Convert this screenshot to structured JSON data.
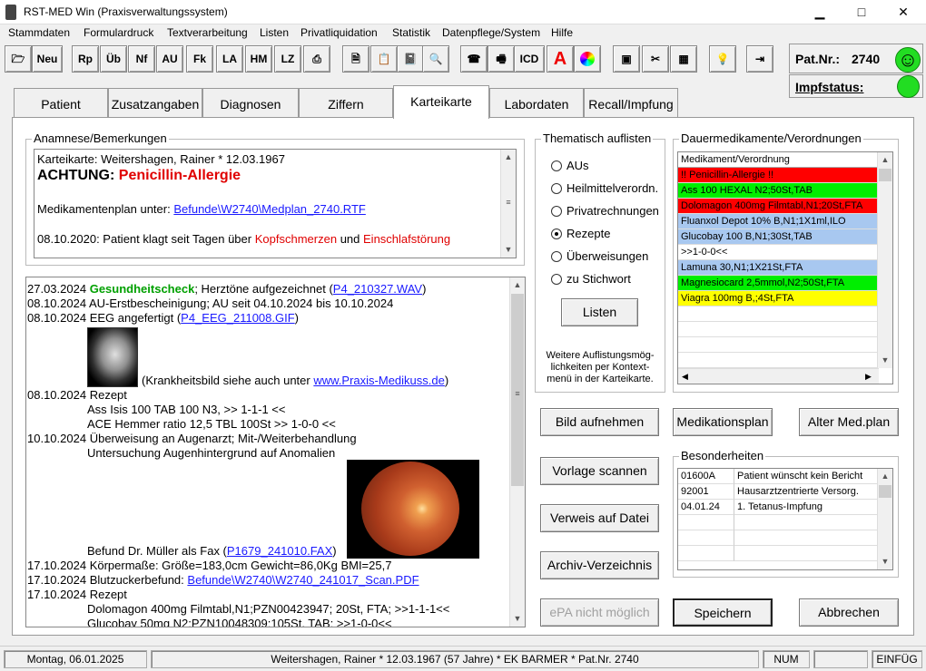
{
  "window": {
    "title": "RST-MED Win (Praxisverwaltungssystem)",
    "minimize": "▁",
    "maximize": "□",
    "close": "✕"
  },
  "menu": [
    "Stammdaten",
    "Formulardruck",
    "Textverarbeitung",
    "Listen",
    "Privatliquidation",
    "Statistik",
    "Datenpflege/System",
    "Hilfe"
  ],
  "toolbar": {
    "text_buttons": [
      "Neu",
      "Rp",
      "Üb",
      "Nf",
      "AU",
      "Fk",
      "LA",
      "HM",
      "LZ",
      "ICD"
    ],
    "icons": [
      "open-folder-icon",
      "printer-icon",
      "document-icon",
      "clipboard-icon",
      "notebook-icon",
      "magnifier-icon",
      "telephone-icon",
      "fax-icon",
      "pharmacy-icon",
      "color-wheel-icon",
      "safe-icon",
      "tools-icon",
      "calculator-icon",
      "lightbulb-icon",
      "exit-icon"
    ]
  },
  "patient": {
    "label": "Pat.Nr.:",
    "number": "2740",
    "impf_label": "Impfstatus:",
    "smiley": "☺"
  },
  "tabs": [
    "Patient",
    "Zusatzangaben",
    "Diagnosen",
    "Ziffern",
    "Karteikarte",
    "Labordaten",
    "Recall/Impfung"
  ],
  "anamnese": {
    "label": "Anamnese/Bemerkungen",
    "line1": "Karteikarte: Weitershagen, Rainer * 12.03.1967",
    "achtung": "ACHTUNG:",
    "allergy": "Penicillin-Allergie",
    "medplan_prefix": "Medikamentenplan unter:",
    "medplan_link": "Befunde\\W2740\\Medplan_2740.RTF",
    "note_prefix": "08.10.2020: Patient klagt seit Tagen über",
    "note_sym1": "Kopfschmerzen",
    "note_and": "und",
    "note_sym2": "Einschlafstörung"
  },
  "kartei": {
    "r1_date": "27.03.2024",
    "r1_green": "Gesundheitscheck",
    "r1_text": "; Herztöne aufgezeichnet (",
    "r1_link": "P4_210327.WAV",
    "r1_end": ")",
    "r2_date": "08.10.2024",
    "r2_text": "AU-Erstbescheinigung; AU seit 04.10.2024 bis 10.10.2024",
    "r3_date": "08.10.2024",
    "r3_text": "EEG angefertigt (",
    "r3_link": "P4_EEG_211008.GIF",
    "r3_end": ")",
    "r3_img_note": "(Krankheitsbild siehe auch unter",
    "r3_img_link": "www.Praxis-Medikuss.de",
    "r3_img_end": ")",
    "r4_date": "08.10.2024",
    "r4_text": "Rezept",
    "r4_l1": "Ass Isis 100 TAB 100 N3, >> 1-1-1 <<",
    "r4_l2": "ACE Hemmer ratio 12,5 TBL 100St >> 1-0-0 <<",
    "r5_date": "10.10.2024",
    "r5_text": "Überweisung an Augenarzt; Mit-/Weiterbehandlung",
    "r5_l1": "Untersuchung Augenhintergrund auf Anomalien",
    "r5_fax_text": "Befund Dr. Müller als Fax (",
    "r5_fax_link": "P1679_241010.FAX",
    "r5_fax_end": ")",
    "r6_date": "17.10.2024",
    "r6_text": "Körpermaße: Größe=183,0cm    Gewicht=86,0Kg    BMI=25,7",
    "r7_date": "17.10.2024",
    "r7_text": "Blutzuckerbefund:",
    "r7_link": "Befunde\\W2740\\W2740_241017_Scan.PDF",
    "r8_date": "17.10.2024",
    "r8_text": "Rezept",
    "r8_l1": "Dolomagon 400mg Filmtabl,N1;PZN00423947; 20St, FTA; >>1-1-1<<",
    "r8_l2": "Glucobay 50mg N2;PZN10048309;105St, TAB; >>1-0-0<<"
  },
  "thematisch": {
    "label": "Thematisch auflisten",
    "options": [
      "AUs",
      "Heilmittelverordn.",
      "Privatrechnungen",
      "Rezepte",
      "Überweisungen",
      "zu Stichwort"
    ],
    "selected": "Rezepte",
    "button": "Listen",
    "hint1": "Weitere Auflistungsmög-",
    "hint2": "lichkeiten per Kontext-",
    "hint3": "menü in der Karteikarte."
  },
  "dauer": {
    "label": "Dauermedikamente/Verordnungen",
    "header": "Medikament/Verordnung",
    "rows": [
      {
        "text": "!! Penicillin-Allergie !!",
        "color": "#ff0000"
      },
      {
        "text": "Ass 100 HEXAL N2;50St,TAB",
        "color": "#00ee00"
      },
      {
        "text": "Dolomagon 400mg Filmtabl,N1;20St,FTA",
        "color": "#ff0000"
      },
      {
        "text": "Fluanxol Depot 10% B,N1;1X1ml,ILO",
        "color": "#a8c8f0"
      },
      {
        "text": "Glucobay 100 B,N1;30St,TAB",
        "color": "#a8c8f0"
      },
      {
        "text": ">>1-0-0<<",
        "color": "#ffffff"
      },
      {
        "text": "Lamuna 30,N1;1X21St,FTA",
        "color": "#a8c8f0"
      },
      {
        "text": "Magnesiocard 2,5mmol,N2;50St,FTA",
        "color": "#00ee00"
      },
      {
        "text": "Viagra 100mg B,;4St,FTA",
        "color": "#ffff00"
      }
    ]
  },
  "buttons": {
    "bild": "Bild aufnehmen",
    "medplan": "Medikationsplan",
    "altermed": "Alter Med.plan",
    "vorlage": "Vorlage scannen",
    "verweis": "Verweis auf Datei",
    "archiv": "Archiv-Verzeichnis",
    "epa": "ePA nicht möglich",
    "speichern": "Speichern",
    "abbrechen": "Abbrechen"
  },
  "besonderheiten": {
    "label": "Besonderheiten",
    "rows": [
      {
        "code": "01600A",
        "text": "Patient wünscht kein Bericht"
      },
      {
        "code": "92001",
        "text": "Hausarztzentrierte Versorg."
      },
      {
        "code": "04.01.24",
        "text": "1. Tetanus-Impfung"
      }
    ]
  },
  "status": {
    "date": "Montag, 06.01.2025",
    "patient": "Weitershagen, Rainer * 12.03.1967 (57 Jahre)  *  EK BARMER  *  Pat.Nr. 2740",
    "num": "NUM",
    "ins": "EINFÜG"
  }
}
